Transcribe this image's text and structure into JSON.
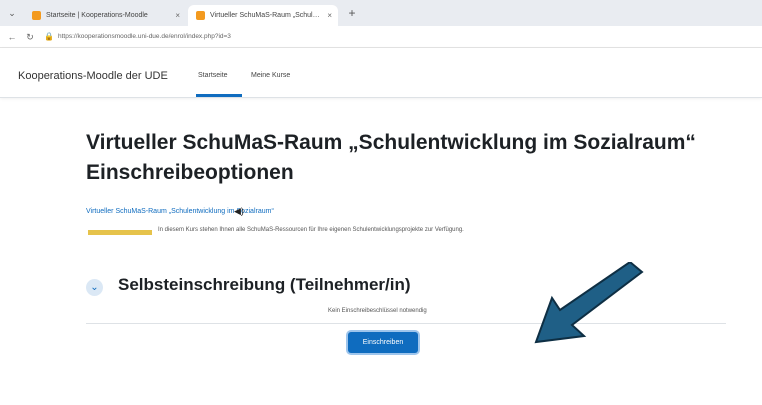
{
  "browser": {
    "tabs": [
      {
        "label": "Startseite | Kooperations-Moodle",
        "close": "×"
      },
      {
        "label": "Virtueller SchuMaS-Raum „Schul…",
        "close": "×"
      }
    ],
    "new_tab": "+",
    "window_menu": "⌄",
    "back": "←",
    "reload": "↻",
    "lock": "🔒",
    "url": "https://kooperationsmoodle.uni-due.de/enrol/index.php?id=3"
  },
  "header": {
    "site_name": "Kooperations-Moodle der UDE",
    "nav": [
      {
        "label": "Startseite",
        "active": true
      },
      {
        "label": "Meine Kurse",
        "active": false
      }
    ],
    "accent": "#0f6cbf"
  },
  "main": {
    "title_line1": "Virtueller SchuMaS-Raum „Schulentwicklung im Sozialraum“",
    "title_line2": "Einschreibeoptionen",
    "course_link": "Virtueller SchuMaS-Raum „Schulentwicklung im Sozialraum“",
    "audio_icon": "◀)",
    "summary": "In diesem Kurs stehen Ihnen alle SchuMaS-Ressourcen für Ihre eigenen Schulentwicklungsprojekte zur Verfügung.",
    "section": {
      "toggle_icon": "⌄",
      "title": "Selbsteinschreibung (Teilnehmer/in)",
      "note": "Kein Einschreibeschlüssel notwendig",
      "button": "Einschreiben"
    }
  },
  "annotation": {
    "arrow_color": "#1f5f86"
  }
}
